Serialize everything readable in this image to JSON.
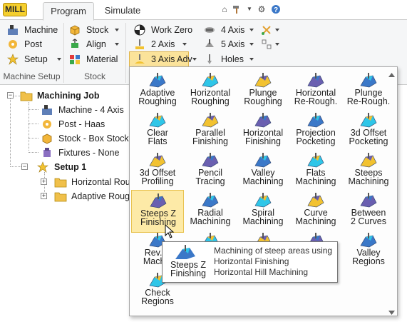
{
  "app": {
    "badge": "MILL",
    "tabs": [
      {
        "label": "Program",
        "active": true
      },
      {
        "label": "Simulate",
        "active": false
      }
    ],
    "top_icons": [
      "home-icon",
      "hammer-icon",
      "gear-icon",
      "help-icon"
    ]
  },
  "ribbon": {
    "machine_setup": {
      "items": [
        {
          "label": "Machine",
          "icon": "machine-icon"
        },
        {
          "label": "Post",
          "icon": "post-icon"
        },
        {
          "label": "Setup",
          "icon": "setup-icon",
          "dropdown": true
        }
      ],
      "group_label": "Machine Setup"
    },
    "stock": {
      "items": [
        {
          "label": "Stock",
          "icon": "stock-box-icon",
          "dropdown": true
        },
        {
          "label": "Align",
          "icon": "align-icon",
          "dropdown": true
        },
        {
          "label": "Material",
          "icon": "material-icon"
        }
      ],
      "group_label": "Stock"
    },
    "toolpaths": {
      "col1": [
        {
          "label": "Work Zero",
          "icon": "work-zero-icon"
        },
        {
          "label": "2 Axis",
          "icon": "two-axis-icon",
          "dropdown": true
        },
        {
          "label": "3 Axis Adv",
          "icon": "three-axis-adv-icon",
          "dropdown": true,
          "active": true
        }
      ],
      "col2": [
        {
          "label": "4 Axis",
          "icon": "four-axis-icon",
          "dropdown": true
        },
        {
          "label": "5 Axis",
          "icon": "five-axis-icon",
          "dropdown": true
        },
        {
          "label": "Holes",
          "icon": "holes-icon",
          "dropdown": true
        }
      ]
    }
  },
  "tree": {
    "root": {
      "label": "Machining Job"
    },
    "children": [
      {
        "label": "Machine - 4 Axis"
      },
      {
        "label": "Post - Haas"
      },
      {
        "label": "Stock - Box Stock"
      },
      {
        "label": "Fixtures - None"
      }
    ],
    "setup": {
      "label": "Setup 1"
    },
    "setup_children": [
      {
        "label": "Horizontal Rough"
      },
      {
        "label": "Adaptive Rough"
      }
    ]
  },
  "menu": {
    "items": [
      {
        "l1": "Adaptive",
        "l2": "Roughing",
        "icon": "adaptive-roughing-icon"
      },
      {
        "l1": "Horizontal",
        "l2": "Roughing",
        "icon": "horizontal-roughing-icon"
      },
      {
        "l1": "Plunge",
        "l2": "Roughing",
        "icon": "plunge-roughing-icon"
      },
      {
        "l1": "Horizontal",
        "l2": "Re-Rough.",
        "icon": "horizontal-rerough-icon"
      },
      {
        "l1": "Plunge",
        "l2": "Re-Rough.",
        "icon": "plunge-rerough-icon"
      },
      {
        "l1": "Clear",
        "l2": "Flats",
        "icon": "clear-flats-icon"
      },
      {
        "l1": "Parallel",
        "l2": "Finishing",
        "icon": "parallel-finishing-icon"
      },
      {
        "l1": "Horizontal",
        "l2": "Finishing",
        "icon": "horizontal-finishing-icon"
      },
      {
        "l1": "Projection",
        "l2": "Pocketing",
        "icon": "projection-pocketing-icon"
      },
      {
        "l1": "3d Offset",
        "l2": "Pocketing",
        "icon": "offset-pocketing-icon"
      },
      {
        "l1": "3d Offset",
        "l2": "Profiling",
        "icon": "offset-profiling-icon"
      },
      {
        "l1": "Pencil",
        "l2": "Tracing",
        "icon": "pencil-tracing-icon"
      },
      {
        "l1": "Valley",
        "l2": "Machining",
        "icon": "valley-machining-icon"
      },
      {
        "l1": "Flats",
        "l2": "Machining",
        "icon": "flats-machining-icon"
      },
      {
        "l1": "Steeps",
        "l2": "Machining",
        "icon": "steeps-machining-icon"
      },
      {
        "l1": "Steeps  Z",
        "l2": "Finishing",
        "icon": "steeps-z-finishing-icon",
        "highlighted": true
      },
      {
        "l1": "Radial",
        "l2": "Machining",
        "icon": "radial-machining-icon"
      },
      {
        "l1": "Spiral",
        "l2": "Machining",
        "icon": "spiral-machining-icon"
      },
      {
        "l1": "Curve",
        "l2": "Machining",
        "icon": "curve-machining-icon"
      },
      {
        "l1": "Between",
        "l2": "2 Curves",
        "icon": "between-curves-icon"
      },
      {
        "l1": "Rev. P",
        "l2": "Machin",
        "icon": "rev-machining-icon"
      },
      {
        "l1": "",
        "l2": "",
        "icon": "hidden-a-icon"
      },
      {
        "l1": "",
        "l2": "",
        "icon": "hidden-b-icon"
      },
      {
        "l1": "",
        "l2": "",
        "icon": "hidden-c-icon"
      },
      {
        "l1": "Valley",
        "l2": "Regions",
        "icon": "valley-regions-icon"
      },
      {
        "l1": "Check",
        "l2": "Regions",
        "icon": "check-regions-icon"
      }
    ]
  },
  "tooltip": {
    "title_l1": "Steeps  Z",
    "title_l2": "Finishing",
    "lines": [
      "Machining of steep areas using",
      "Horizontal Finishing",
      "Horizontal Hill Machining"
    ]
  },
  "colors": {
    "accent": "#f5cf2d",
    "highlight": "#fdeaa7",
    "icon_blue": "#3b78c8",
    "icon_cyan": "#2fc6e8",
    "icon_yellow": "#f2c230",
    "icon_purple": "#6a5fb0",
    "folder": "#f0c04a"
  }
}
